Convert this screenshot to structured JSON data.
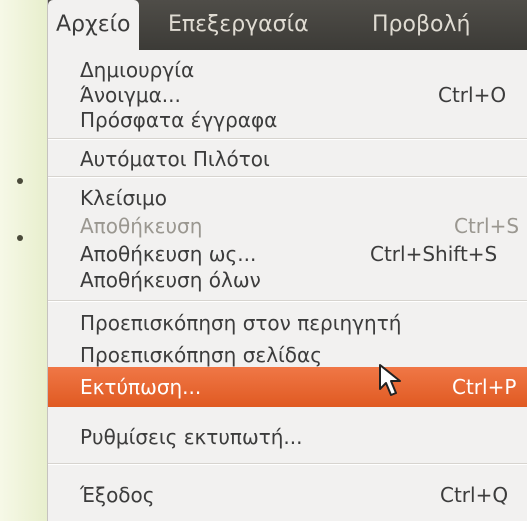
{
  "menubar": {
    "items": [
      {
        "label": "Αρχείο"
      },
      {
        "label": "Επεξεργασία"
      },
      {
        "label": "Προβολή"
      }
    ]
  },
  "menu": {
    "items": [
      {
        "label": "Δημιουργία",
        "shortcut": ""
      },
      {
        "label": "Άνοιγμα...",
        "shortcut": "Ctrl+O"
      },
      {
        "label": "Πρόσφατα έγγραφα",
        "shortcut": ""
      },
      {
        "label": "Αυτόματοι Πιλότοι",
        "shortcut": ""
      },
      {
        "label": "Κλείσιμο",
        "shortcut": ""
      },
      {
        "label": "Αποθήκευση",
        "shortcut": "Ctrl+S"
      },
      {
        "label": "Αποθήκευση ως...",
        "shortcut": "Ctrl+Shift+S"
      },
      {
        "label": "Αποθήκευση όλων",
        "shortcut": ""
      },
      {
        "label": "Προεπισκόπηση στον περιηγητή",
        "shortcut": ""
      },
      {
        "label": "Προεπισκόπηση σελίδας",
        "shortcut": ""
      },
      {
        "label": "Εκτύπωση...",
        "shortcut": "Ctrl+P"
      },
      {
        "label": "Ρυθμίσεις εκτυπωτή...",
        "shortcut": ""
      },
      {
        "label": "Έξοδος",
        "shortcut": "Ctrl+Q"
      }
    ]
  },
  "colors": {
    "menubar_bg": "#3c3b37",
    "menu_bg": "#f2f1f0",
    "highlight": "#e9622a",
    "text": "#3c3c3c",
    "disabled_text": "#9a9790"
  }
}
